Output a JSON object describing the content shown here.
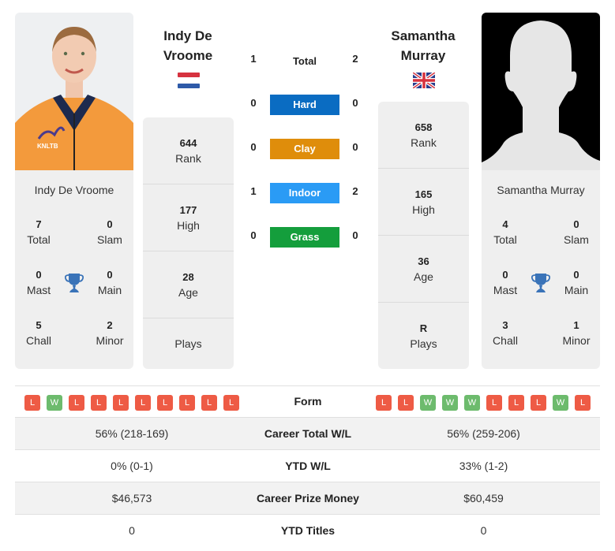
{
  "colors": {
    "hard": "#0a6cc2",
    "clay": "#df8d0b",
    "indoor": "#2a9bf5",
    "grass": "#149e3c",
    "loss": "#ee5b45",
    "win": "#6dbb6d",
    "trophy": "#3a73b8"
  },
  "player1": {
    "name": "Indy De Vroome",
    "header_line1": "Indy De",
    "header_line2": "Vroome",
    "flag": "netherlands-flag",
    "photo": "player-photo",
    "stats": {
      "rank": "644",
      "rank_label": "Rank",
      "high": "177",
      "high_label": "High",
      "age": "28",
      "age_label": "Age",
      "plays": "",
      "plays_label": "Plays"
    },
    "titles": {
      "total": "7",
      "total_label": "Total",
      "slam": "0",
      "slam_label": "Slam",
      "mast": "0",
      "mast_label": "Mast",
      "main": "0",
      "main_label": "Main",
      "chall": "5",
      "chall_label": "Chall",
      "minor": "2",
      "minor_label": "Minor"
    },
    "form": [
      "L",
      "W",
      "L",
      "L",
      "L",
      "L",
      "L",
      "L",
      "L",
      "L"
    ],
    "career_wl": "56% (218-169)",
    "ytd_wl": "0% (0-1)",
    "prize_money": "$46,573",
    "ytd_titles": "0"
  },
  "player2": {
    "name": "Samantha Murray",
    "header_line1": "Samantha",
    "header_line2": "Murray",
    "flag": "uk-flag",
    "photo": "silhouette-placeholder",
    "stats": {
      "rank": "658",
      "rank_label": "Rank",
      "high": "165",
      "high_label": "High",
      "age": "36",
      "age_label": "Age",
      "plays": "R",
      "plays_label": "Plays"
    },
    "titles": {
      "total": "4",
      "total_label": "Total",
      "slam": "0",
      "slam_label": "Slam",
      "mast": "0",
      "mast_label": "Mast",
      "main": "0",
      "main_label": "Main",
      "chall": "3",
      "chall_label": "Chall",
      "minor": "1",
      "minor_label": "Minor"
    },
    "form": [
      "L",
      "L",
      "W",
      "W",
      "W",
      "L",
      "L",
      "L",
      "W",
      "L"
    ],
    "career_wl": "56% (259-206)",
    "ytd_wl": "33% (1-2)",
    "prize_money": "$60,459",
    "ytd_titles": "0"
  },
  "h2h": {
    "total": {
      "label": "Total",
      "p1": "1",
      "p2": "2"
    },
    "surfaces": [
      {
        "label": "Hard",
        "p1": "0",
        "p2": "0"
      },
      {
        "label": "Clay",
        "p1": "0",
        "p2": "0"
      },
      {
        "label": "Indoor",
        "p1": "1",
        "p2": "2"
      },
      {
        "label": "Grass",
        "p1": "0",
        "p2": "0"
      }
    ]
  },
  "table": {
    "form_label": "Form",
    "career_wl_label": "Career Total W/L",
    "ytd_wl_label": "YTD W/L",
    "prize_label": "Career Prize Money",
    "ytd_titles_label": "YTD Titles"
  }
}
